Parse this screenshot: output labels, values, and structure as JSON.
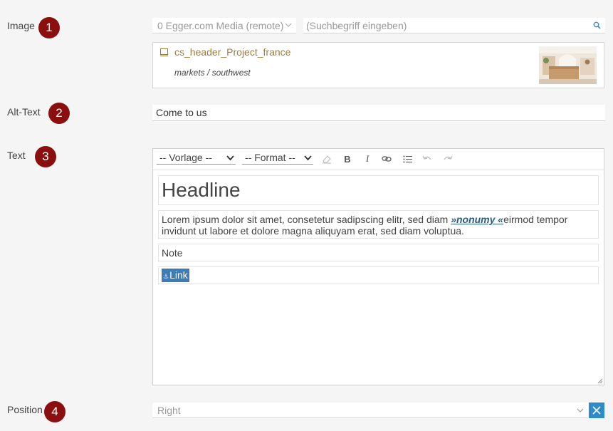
{
  "rows": {
    "image": {
      "label": "Image",
      "badge": "1"
    },
    "alt": {
      "label": "Alt-Text",
      "badge": "2"
    },
    "text": {
      "label": "Text",
      "badge": "3"
    },
    "position": {
      "label": "Position",
      "badge": "4"
    }
  },
  "image": {
    "media_source": "0 Egger.com Media (remote)",
    "search_placeholder": "(Suchbegriff eingeben)",
    "search_value": "",
    "file_name": "cs_header_Project_france",
    "file_path": "markets / southwest"
  },
  "alt_text": {
    "value": "Come to us"
  },
  "editor": {
    "template_select": "-- Vorlage --",
    "format_select": "-- Format --",
    "toolbar_icons": [
      "eraser-icon",
      "bold-icon",
      "italic-icon",
      "link-icon",
      "list-icon",
      "undo-icon",
      "redo-icon"
    ],
    "headline": "Headline",
    "paragraph_before": "Lorem ipsum dolor sit amet, consetetur sadipscing elitr, sed diam ",
    "paragraph_link": "»nonumy «",
    "paragraph_after": "eirmod tempor invidunt ut labore et dolore magna aliquyam erat, sed diam voluptua.",
    "note": "Note",
    "link": "Link"
  },
  "position": {
    "value": "Right"
  },
  "colors": {
    "badge": "#8b0f0f",
    "file_name": "#a07d3a",
    "link_highlight": "#3d7cb5",
    "clear_button": "#2f8ccb"
  }
}
